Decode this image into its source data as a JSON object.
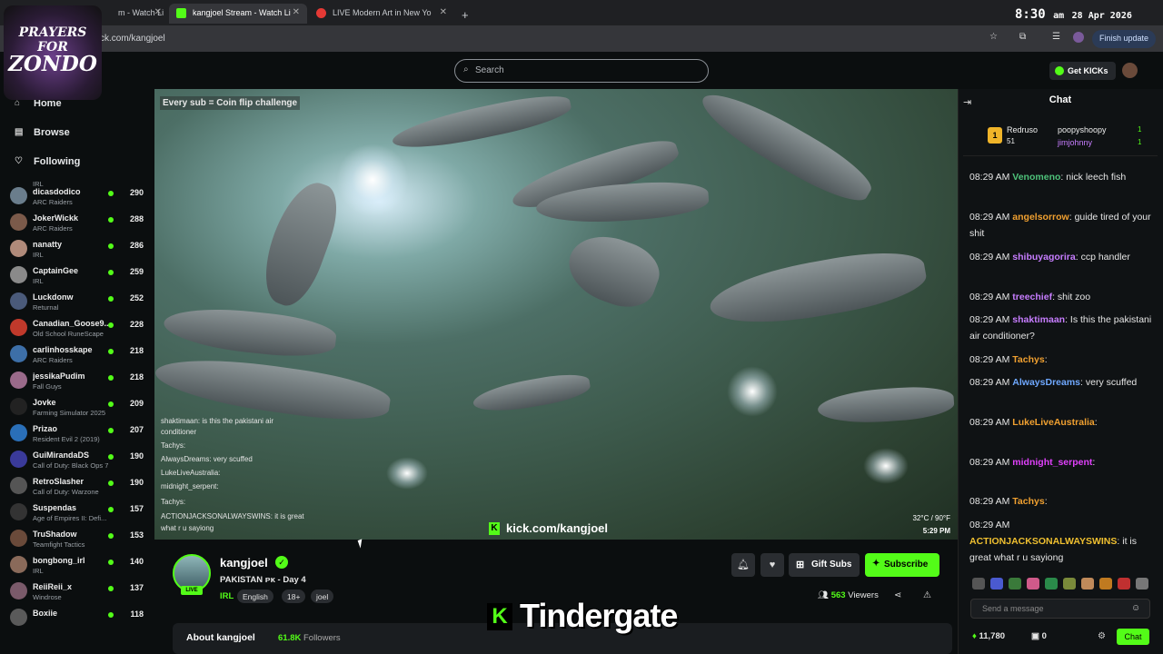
{
  "clock": {
    "time": "8:30",
    "ampm": "am",
    "date": "28 Apr 2026"
  },
  "logo": {
    "line1": "PRAYERS FOR",
    "line2": "ZONDO"
  },
  "browser": {
    "tabs": [
      {
        "title": "m - Watch Li"
      },
      {
        "title": "kangjoel Stream - Watch Li"
      },
      {
        "title": "LIVE Modern Art in New Yo"
      }
    ],
    "url": "ck.com/kangjoel",
    "finish_update": "Finish update"
  },
  "topbar": {
    "search_placeholder": "Search",
    "get_kicks": "Get KICKs"
  },
  "sidebar": {
    "nav": [
      {
        "label": "Home"
      },
      {
        "label": "Browse"
      },
      {
        "label": "Following"
      }
    ],
    "top_category": "IRL",
    "channels": [
      {
        "name": "dicasdodico",
        "category": "ARC Raiders",
        "viewers": "290",
        "color": "#6a7d8c"
      },
      {
        "name": "JokerWickk",
        "category": "ARC Raiders",
        "viewers": "288",
        "color": "#7b5a4a"
      },
      {
        "name": "nanatty",
        "category": "IRL",
        "viewers": "286",
        "color": "#b08a7a"
      },
      {
        "name": "CaptainGee",
        "category": "IRL",
        "viewers": "259",
        "color": "#8a8a8a"
      },
      {
        "name": "Luckdonw",
        "category": "Returnal",
        "viewers": "252",
        "color": "#4a5a7a"
      },
      {
        "name": "Canadian_Goose9...",
        "category": "Old School RuneScape",
        "viewers": "228",
        "color": "#c0392b"
      },
      {
        "name": "carlinhosskape",
        "category": "ARC Raiders",
        "viewers": "218",
        "color": "#3d6fa8"
      },
      {
        "name": "jessikaPudim",
        "category": "Fall Guys",
        "viewers": "218",
        "color": "#9a6a8a"
      },
      {
        "name": "Jovke",
        "category": "Farming Simulator 2025",
        "viewers": "209",
        "color": "#222"
      },
      {
        "name": "Prizao",
        "category": "Resident Evil 2 (2019)",
        "viewers": "207",
        "color": "#2a6fb8"
      },
      {
        "name": "GuiMirandaDS",
        "category": "Call of Duty: Black Ops 7",
        "viewers": "190",
        "color": "#3a3a9a"
      },
      {
        "name": "RetroSlasher",
        "category": "Call of Duty: Warzone",
        "viewers": "190",
        "color": "#555"
      },
      {
        "name": "Suspendas",
        "category": "Age of Empires II: Defi...",
        "viewers": "157",
        "color": "#333"
      },
      {
        "name": "TruShadow",
        "category": "Teamfight Tactics",
        "viewers": "153",
        "color": "#6a4a3a"
      },
      {
        "name": "bongbong_irl",
        "category": "IRL",
        "viewers": "140",
        "color": "#8a6a5a"
      },
      {
        "name": "ReiiReii_x",
        "category": "Windrose",
        "viewers": "137",
        "color": "#7a5a6a"
      },
      {
        "name": "Boxiie",
        "category": "",
        "viewers": "118",
        "color": "#5a5a5a"
      }
    ]
  },
  "video": {
    "overlay_title": "Every sub = Coin flip challenge",
    "watermark": "kick.com/kangjoel",
    "temperature": "32°C / 90°F",
    "time": "5:29 PM",
    "overlay_chat": [
      {
        "text": "shaktimaan: is this the pakistani air"
      },
      {
        "text": "conditioner"
      },
      {
        "text": "Tachys:"
      },
      {
        "text": "AlwaysDreams: very scuffed"
      },
      {
        "text": "LukeLiveAustralia:"
      },
      {
        "text": "midnight_serpent:"
      },
      {
        "text": "Tachys:"
      },
      {
        "text": "ACTIONJACKSONALWAYSWINS: it is great"
      },
      {
        "text": "what r u sayiong"
      }
    ]
  },
  "streamer": {
    "name": "kangjoel",
    "title": "PAKISTAN ᴘᴋ - Day 4",
    "category": "IRL",
    "tags": [
      "English",
      "18+",
      "joel"
    ],
    "live_label": "LIVE",
    "viewers_count": "563",
    "viewers_label": "Viewers",
    "gift_subs": "Gift Subs",
    "subscribe": "Subscribe",
    "about": "About kangjoel",
    "followers_count": "61.8K",
    "followers_label": "Followers",
    "big_title": "Tindergate"
  },
  "chat": {
    "header": "Chat",
    "gifters": [
      {
        "name": "Redruso",
        "count": "51"
      },
      {
        "name": "poopyshoopy",
        "count": "1"
      },
      {
        "name": "jimjohnny",
        "count": "1"
      }
    ],
    "messages": [
      {
        "time": "08:29 AM",
        "user": "Venomeno",
        "color": "#4ec27a",
        "text": "nick leech fish"
      },
      {
        "time": "08:29 AM",
        "user": "angelsorrow",
        "color": "#f0a030",
        "text": "guide tired of your shit"
      },
      {
        "time": "08:29 AM",
        "user": "shibuyagorira",
        "color": "#c77dff",
        "text": "ccp handler"
      },
      {
        "time": "08:29 AM",
        "user": "treechief",
        "color": "#c77dff",
        "text": "shit zoo"
      },
      {
        "time": "08:29 AM",
        "user": "shaktimaan",
        "color": "#c77dff",
        "text": "Is this the pakistani air conditioner?"
      },
      {
        "time": "08:29 AM",
        "user": "Tachys",
        "color": "#f0a030",
        "text": ""
      },
      {
        "time": "08:29 AM",
        "user": "AlwaysDreams",
        "color": "#6fa8ff",
        "text": "very scuffed"
      },
      {
        "time": "08:29 AM",
        "user": "LukeLiveAustralia",
        "color": "#f0a030",
        "text": ""
      },
      {
        "time": "08:29 AM",
        "user": "midnight_serpent",
        "color": "#e040fb",
        "text": ""
      },
      {
        "time": "08:29 AM",
        "user": "Tachys",
        "color": "#f0a030",
        "text": ""
      },
      {
        "time": "08:29 AM",
        "user": "ACTIONJACKSONALWAYSWINS",
        "color": "#f0c030",
        "text": "it is great what r u sayiong"
      }
    ],
    "send_placeholder": "Send a message",
    "kicks_balance": "11,780",
    "points": "0",
    "chat_button": "Chat"
  }
}
